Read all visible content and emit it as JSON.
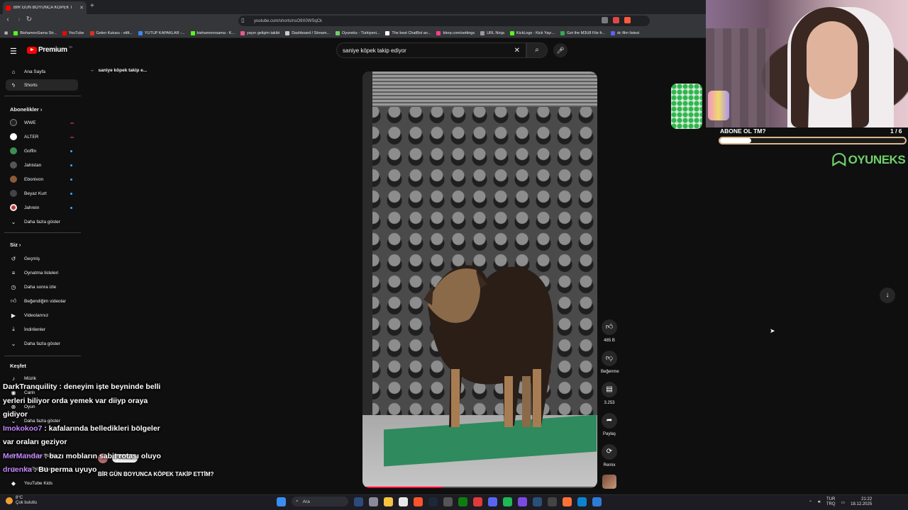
{
  "browser": {
    "tab_title": "BİR GÜN BOYUNCA KÖPEK T",
    "url": "youtube.com/shorts/nsO9X0WSqCk",
    "bookmarks": [
      "BishamonSama Str...",
      "YouTube",
      "Gelen Kutusu - elift...",
      "YUTUP KAPAKLAR -...",
      "bishamonnsama - K...",
      "yayın gelişim takibi",
      "Dashboard / Stream...",
      "Oyuneks - Türkiyeni...",
      "The best ChatBot an...",
      "blerp.com/settings",
      "URL Ninja",
      "KickLogs - Kick Yayı...",
      "Get the M3U8 File fr...",
      "dc film listesi"
    ]
  },
  "youtube": {
    "logo_text": "Premium",
    "logo_region": "TR",
    "search_query": "saniye köpek takip ediyor",
    "back_label": "saniye köpek takip e...",
    "sidebar": {
      "home": "Ana Sayfa",
      "shorts": "Shorts",
      "subs_header": "Abonelikler",
      "channels": [
        "WWE",
        "ALTER",
        "Goffin",
        "Jahistan",
        "Ebonivon",
        "Beyaz Kurt",
        "Jahrein"
      ],
      "channel_more": "Daha fazla göster",
      "you_header": "Siz",
      "you_items": [
        "Geçmiş",
        "Oynatma listeleri",
        "Daha sonra izle",
        "Beğendiğim videolar",
        "Videolarınız",
        "İndirilenler",
        "Daha fazla göster"
      ],
      "explore_header": "Keşfet",
      "explore_items": [
        "Müzik",
        "Canlı",
        "Oyun",
        "Daha fazla göster",
        "YouTube Studio",
        "YouTube Music",
        "YouTube Kids"
      ]
    },
    "actions": {
      "likes": "485 B",
      "dislike": "Beğenme",
      "comments": "3.253",
      "share": "Paylaş",
      "remix": "Remix"
    },
    "short_title": "BİR GÜN BOYUNCA KÖPEK TAKİP ETTİM?",
    "subscribe_label": "Abone ol",
    "video_progress": 0.34
  },
  "chat": [
    {
      "user": "DarkTranquility",
      "msg": " : deneyim işte beyninde belli yerleri biliyor orda yemek var diiyp oraya gidiyor",
      "color": "#ffffff"
    },
    {
      "user": "Imokokoo7",
      "msg": " : kafalarında belledikleri bölgeler var oraları geziyor",
      "color": "#c586ff"
    },
    {
      "user": "MerMandar",
      "msg": " : bazı mobların sabit rotası oluyo",
      "color": "#c586ff"
    },
    {
      "user": "druenka",
      "msg": " : Bu perma uyuyo",
      "color": "#c586ff"
    }
  ],
  "overlay": {
    "goal_title": "ABONE OL TM?",
    "goal_count": "1 / 6",
    "goal_progress": 0.1667,
    "brand": "OYUNEKS"
  },
  "taskbar": {
    "temp": "8°C",
    "weather": "Çok bulutlu",
    "search": "Ara",
    "lang1": "TUR",
    "lang2": "TRQ",
    "time": "21:22",
    "date": "18.12.2025"
  },
  "colors": {
    "yt_red": "#ff0000",
    "chat_name": "#c586ff",
    "brand_green": "#6fd06b"
  }
}
